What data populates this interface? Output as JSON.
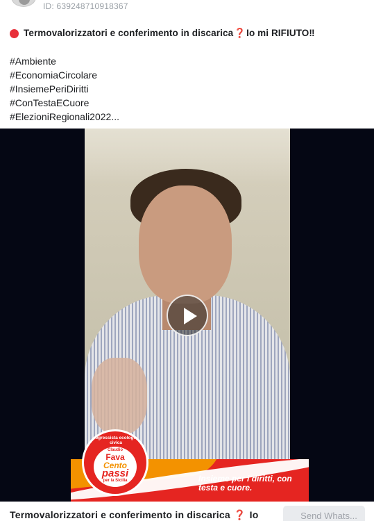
{
  "post": {
    "id_label": "ID: 639248710918367",
    "title_prefix": "Termovalorizzatori e conferimento in discarica",
    "title_qmark": "❓",
    "title_suffix": " Io mi RIFIUTO‼",
    "hashtags": [
      "#Ambiente",
      "#EconomiaCircolare",
      "#InsiemePeriDiritti",
      "#ConTestaECuore",
      "#ElezioniRegionali2022..."
    ]
  },
  "video": {
    "banner_slogan": "Insieme per i diritti, con testa e cuore.",
    "logo": {
      "arc_text": "Progressista ecologista civica",
      "claudio": "Claudio",
      "fava": "Fava",
      "cento": "Cento",
      "passi": "passi",
      "sicilia": "per la Sicilia"
    }
  },
  "bottom": {
    "title_prefix": "Termovalorizzatori e conferimento in discarica",
    "title_qmark": "❓",
    "title_suffix": " Io",
    "send_button": "Send Whats..."
  },
  "colors": {
    "accent_red": "#e8303a",
    "banner_red": "#e52521",
    "banner_orange": "#f39200"
  }
}
